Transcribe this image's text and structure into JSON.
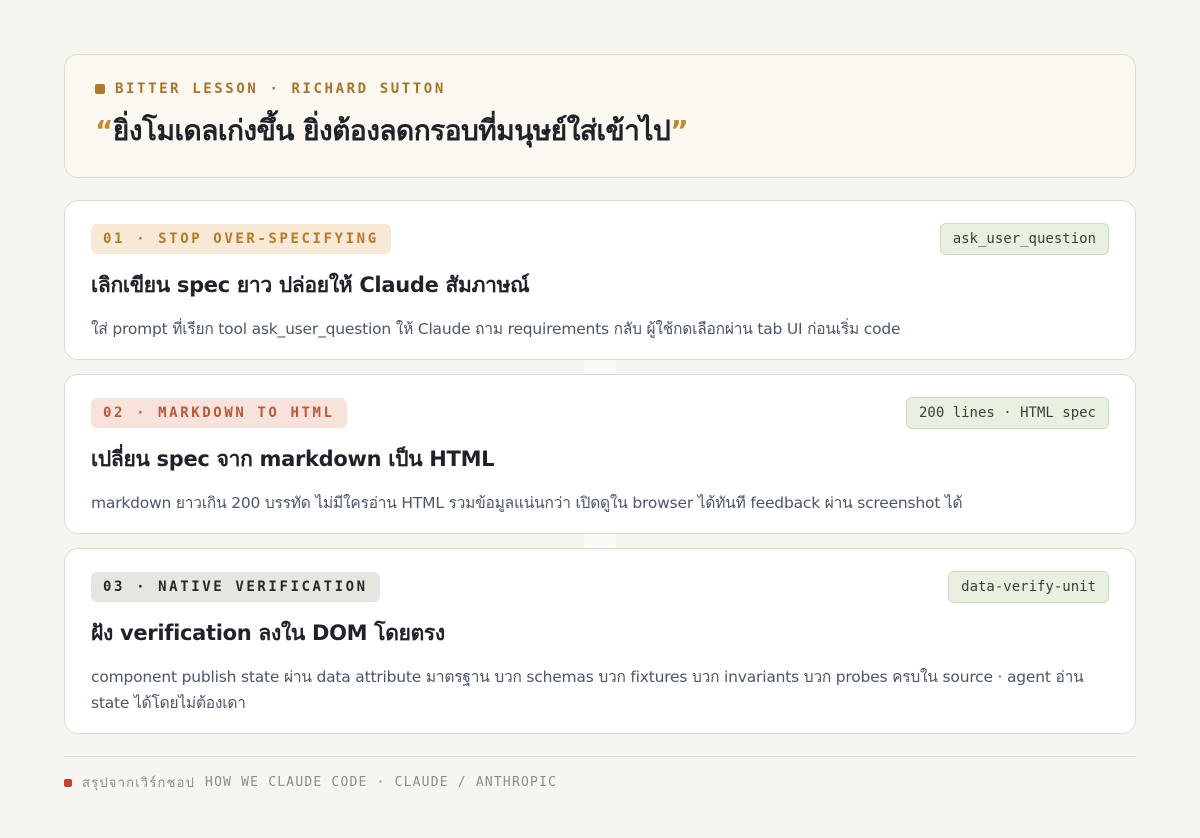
{
  "hero": {
    "eyebrow": "BITTER LESSON · RICHARD SUTTON",
    "quote_open": "“",
    "quote_text": "ยิ่งโมเดลเก่งขึ้น ยิ่งต้องลดกรอบที่มนุษย์ใส่เข้าไป",
    "quote_close": "”"
  },
  "cards": [
    {
      "label": "01 · STOP OVER-SPECIFYING",
      "tag": "ask_user_question",
      "title": "เลิกเขียน spec ยาว ปล่อยให้ Claude สัมภาษณ์",
      "body": "ใส่ prompt ที่เรียก tool ask_user_question ให้ Claude ถาม requirements กลับ ผู้ใช้กดเลือกผ่าน tab UI ก่อนเริ่ม code"
    },
    {
      "label": "02 · MARKDOWN TO HTML",
      "tag": "200 lines · HTML spec",
      "title": "เปลี่ยน spec จาก markdown เป็น HTML",
      "body": "markdown ยาวเกิน 200 บรรทัด ไม่มีใครอ่าน HTML รวมข้อมูลแน่นกว่า เปิดดูใน browser ได้ทันที feedback ผ่าน screenshot ได้"
    },
    {
      "label": "03 · NATIVE VERIFICATION",
      "tag": "data-verify-unit",
      "title": "ฝัง verification ลงใน DOM โดยตรง",
      "body": "component publish state ผ่าน data attribute มาตรฐาน บวก schemas บวก fixtures บวก invariants บวก probes ครบใน source · agent อ่าน state ได้โดยไม่ต้องเดา"
    }
  ],
  "footer": {
    "prefix": "สรุปจากเวิร์กชอป",
    "text": "HOW WE CLAUDE CODE · CLAUDE / ANTHROPIC"
  }
}
